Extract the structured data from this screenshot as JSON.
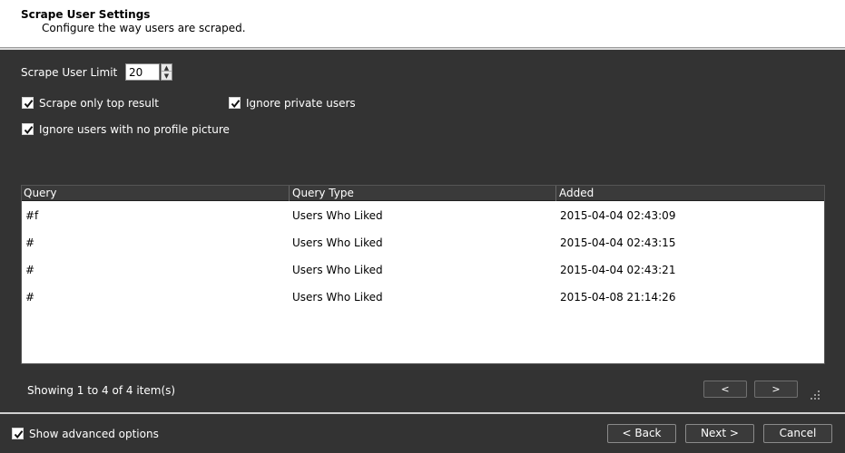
{
  "header": {
    "title": "Scrape User Settings",
    "subtitle": "Configure the way users are scraped."
  },
  "settings": {
    "limit_label": "Scrape User Limit",
    "limit_value": "20",
    "scrape_top_label": "Scrape only top result",
    "scrape_top_checked": true,
    "ignore_private_label": "Ignore private users",
    "ignore_private_checked": true,
    "ignore_no_pic_label": "Ignore users with no profile picture",
    "ignore_no_pic_checked": true
  },
  "grid": {
    "columns": [
      "Query",
      "Query Type",
      "Added"
    ],
    "rows": [
      {
        "query": "#f",
        "type": "Users Who Liked",
        "added": "2015-04-04 02:43:09"
      },
      {
        "query": "#",
        "type": "Users Who Liked",
        "added": "2015-04-04 02:43:15"
      },
      {
        "query": "#",
        "type": "Users Who Liked",
        "added": "2015-04-04 02:43:21"
      },
      {
        "query": "#",
        "type": "Users Who Liked",
        "added": "2015-04-08 21:14:26"
      }
    ],
    "status": "Showing 1 to 4 of 4 item(s)",
    "prev_label": "<",
    "next_label": ">"
  },
  "footer": {
    "advanced_label": "Show advanced options",
    "advanced_checked": true,
    "back_label": "< Back",
    "next_label": "Next >",
    "cancel_label": "Cancel"
  }
}
